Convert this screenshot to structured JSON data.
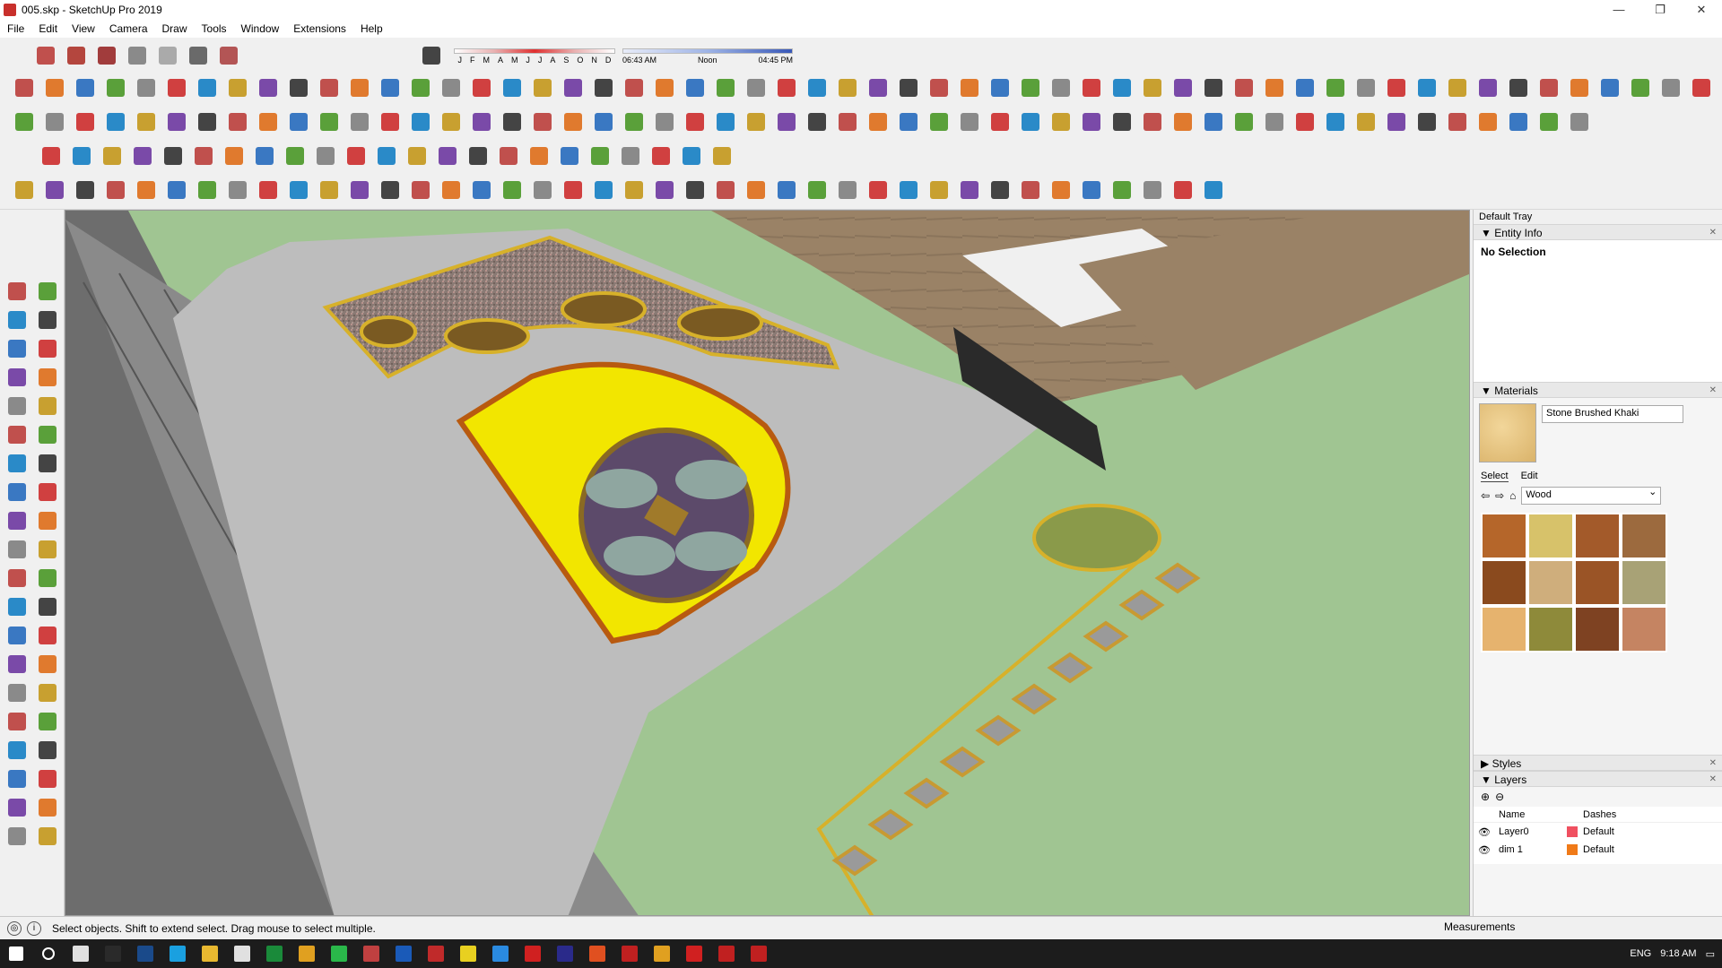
{
  "window": {
    "title": "005.skp - SketchUp Pro 2019",
    "controls": {
      "minimize": "—",
      "maximize": "❐",
      "close": "✕"
    }
  },
  "menu": [
    "File",
    "Edit",
    "View",
    "Camera",
    "Draw",
    "Tools",
    "Window",
    "Extensions",
    "Help"
  ],
  "shadow": {
    "months": [
      "J",
      "F",
      "M",
      "A",
      "M",
      "J",
      "J",
      "A",
      "S",
      "O",
      "N",
      "D"
    ],
    "time_start": "06:43 AM",
    "time_mid": "Noon",
    "time_end": "04:45 PM"
  },
  "tray": {
    "title": "Default Tray",
    "entity_info": {
      "header": "Entity Info",
      "selection": "No Selection"
    },
    "materials": {
      "header": "Materials",
      "current_name": "Stone Brushed Khaki",
      "tab_select": "Select",
      "tab_edit": "Edit",
      "library": "Wood",
      "swatch_colors": [
        "#b5662a",
        "#d7c26a",
        "#a35a2a",
        "#9c6a3e",
        "#8a4a1e",
        "#cfae7c",
        "#9a5426",
        "#a8a276",
        "#e6b36e",
        "#8e8a3a",
        "#7e4222",
        "#c58462"
      ]
    },
    "styles": {
      "header": "Styles"
    },
    "layers": {
      "header": "Layers",
      "col_name": "Name",
      "col_dashes": "Dashes",
      "rows": [
        {
          "name": "Layer0",
          "color": "#f05060",
          "dashes": "Default"
        },
        {
          "name": "dim 1",
          "color": "#f07a18",
          "dashes": "Default"
        }
      ]
    }
  },
  "status": {
    "message": "Select objects. Shift to extend select. Drag mouse to select multiple.",
    "measurements_label": "Measurements"
  },
  "taskbar": {
    "language": "ENG",
    "time": "9:18 AM"
  }
}
